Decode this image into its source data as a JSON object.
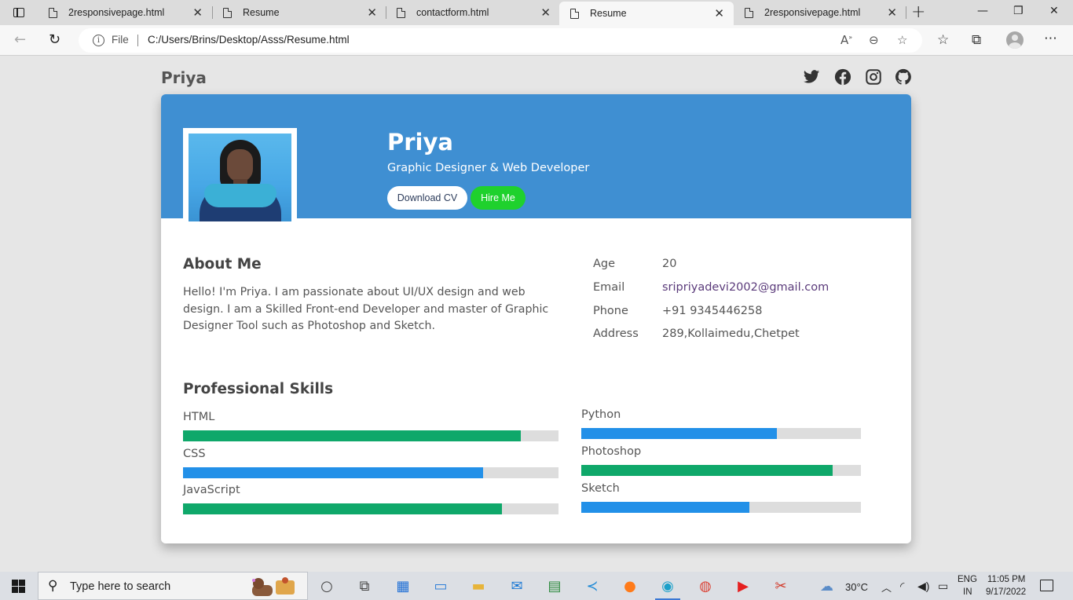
{
  "browser": {
    "tabs": [
      {
        "title": "2responsivepage.html",
        "active": false
      },
      {
        "title": "Resume",
        "active": false
      },
      {
        "title": "contactform.html",
        "active": false
      },
      {
        "title": "Resume",
        "active": true
      },
      {
        "title": "2responsivepage.html",
        "active": false
      }
    ],
    "address": {
      "scheme_label": "File",
      "url": "C:/Users/Brins/Desktop/Asss/Resume.html"
    }
  },
  "site": {
    "brand": "Priya",
    "social_icons": [
      "twitter-icon",
      "facebook-icon",
      "instagram-icon",
      "github-icon"
    ]
  },
  "hero": {
    "name": "Priya",
    "role": "Graphic Designer & Web Developer",
    "download_label": "Download CV",
    "hire_label": "Hire Me"
  },
  "about": {
    "title": "About Me",
    "text": "Hello! I'm Priya. I am passionate about UI/UX design and web design. I am a Skilled Front-end Developer and master of Graphic Designer Tool such as Photoshop and Sketch."
  },
  "info": [
    {
      "label": "Age",
      "value": "20"
    },
    {
      "label": "Email",
      "value": "sripriyadevi2002@gmail.com"
    },
    {
      "label": "Phone",
      "value": "+91 9345446258"
    },
    {
      "label": "Address",
      "value": "289,Kollaimedu,Chetpet"
    }
  ],
  "skills": {
    "title": "Professional Skills",
    "left": [
      {
        "name": "HTML",
        "level": 0.9,
        "color": "#0fa86a"
      },
      {
        "name": "CSS",
        "level": 0.8,
        "color": "#2290e8"
      },
      {
        "name": "JavaScript",
        "level": 0.85,
        "color": "#0fa86a"
      }
    ],
    "right": [
      {
        "name": "Python",
        "level": 0.7,
        "color": "#2290e8"
      },
      {
        "name": "Photoshop",
        "level": 0.9,
        "color": "#0fa86a"
      },
      {
        "name": "Sketch",
        "level": 0.6,
        "color": "#2290e8"
      }
    ]
  },
  "colors": {
    "header": "#3f8fd2",
    "hire_button": "#1fd12d",
    "skill_green": "#0fa86a",
    "skill_blue": "#2290e8"
  },
  "taskbar": {
    "search_placeholder": "Type here to search",
    "weather": "30°C",
    "language_line1": "ENG",
    "language_line2": "IN",
    "time": "11:05 PM",
    "date": "9/17/2022"
  }
}
